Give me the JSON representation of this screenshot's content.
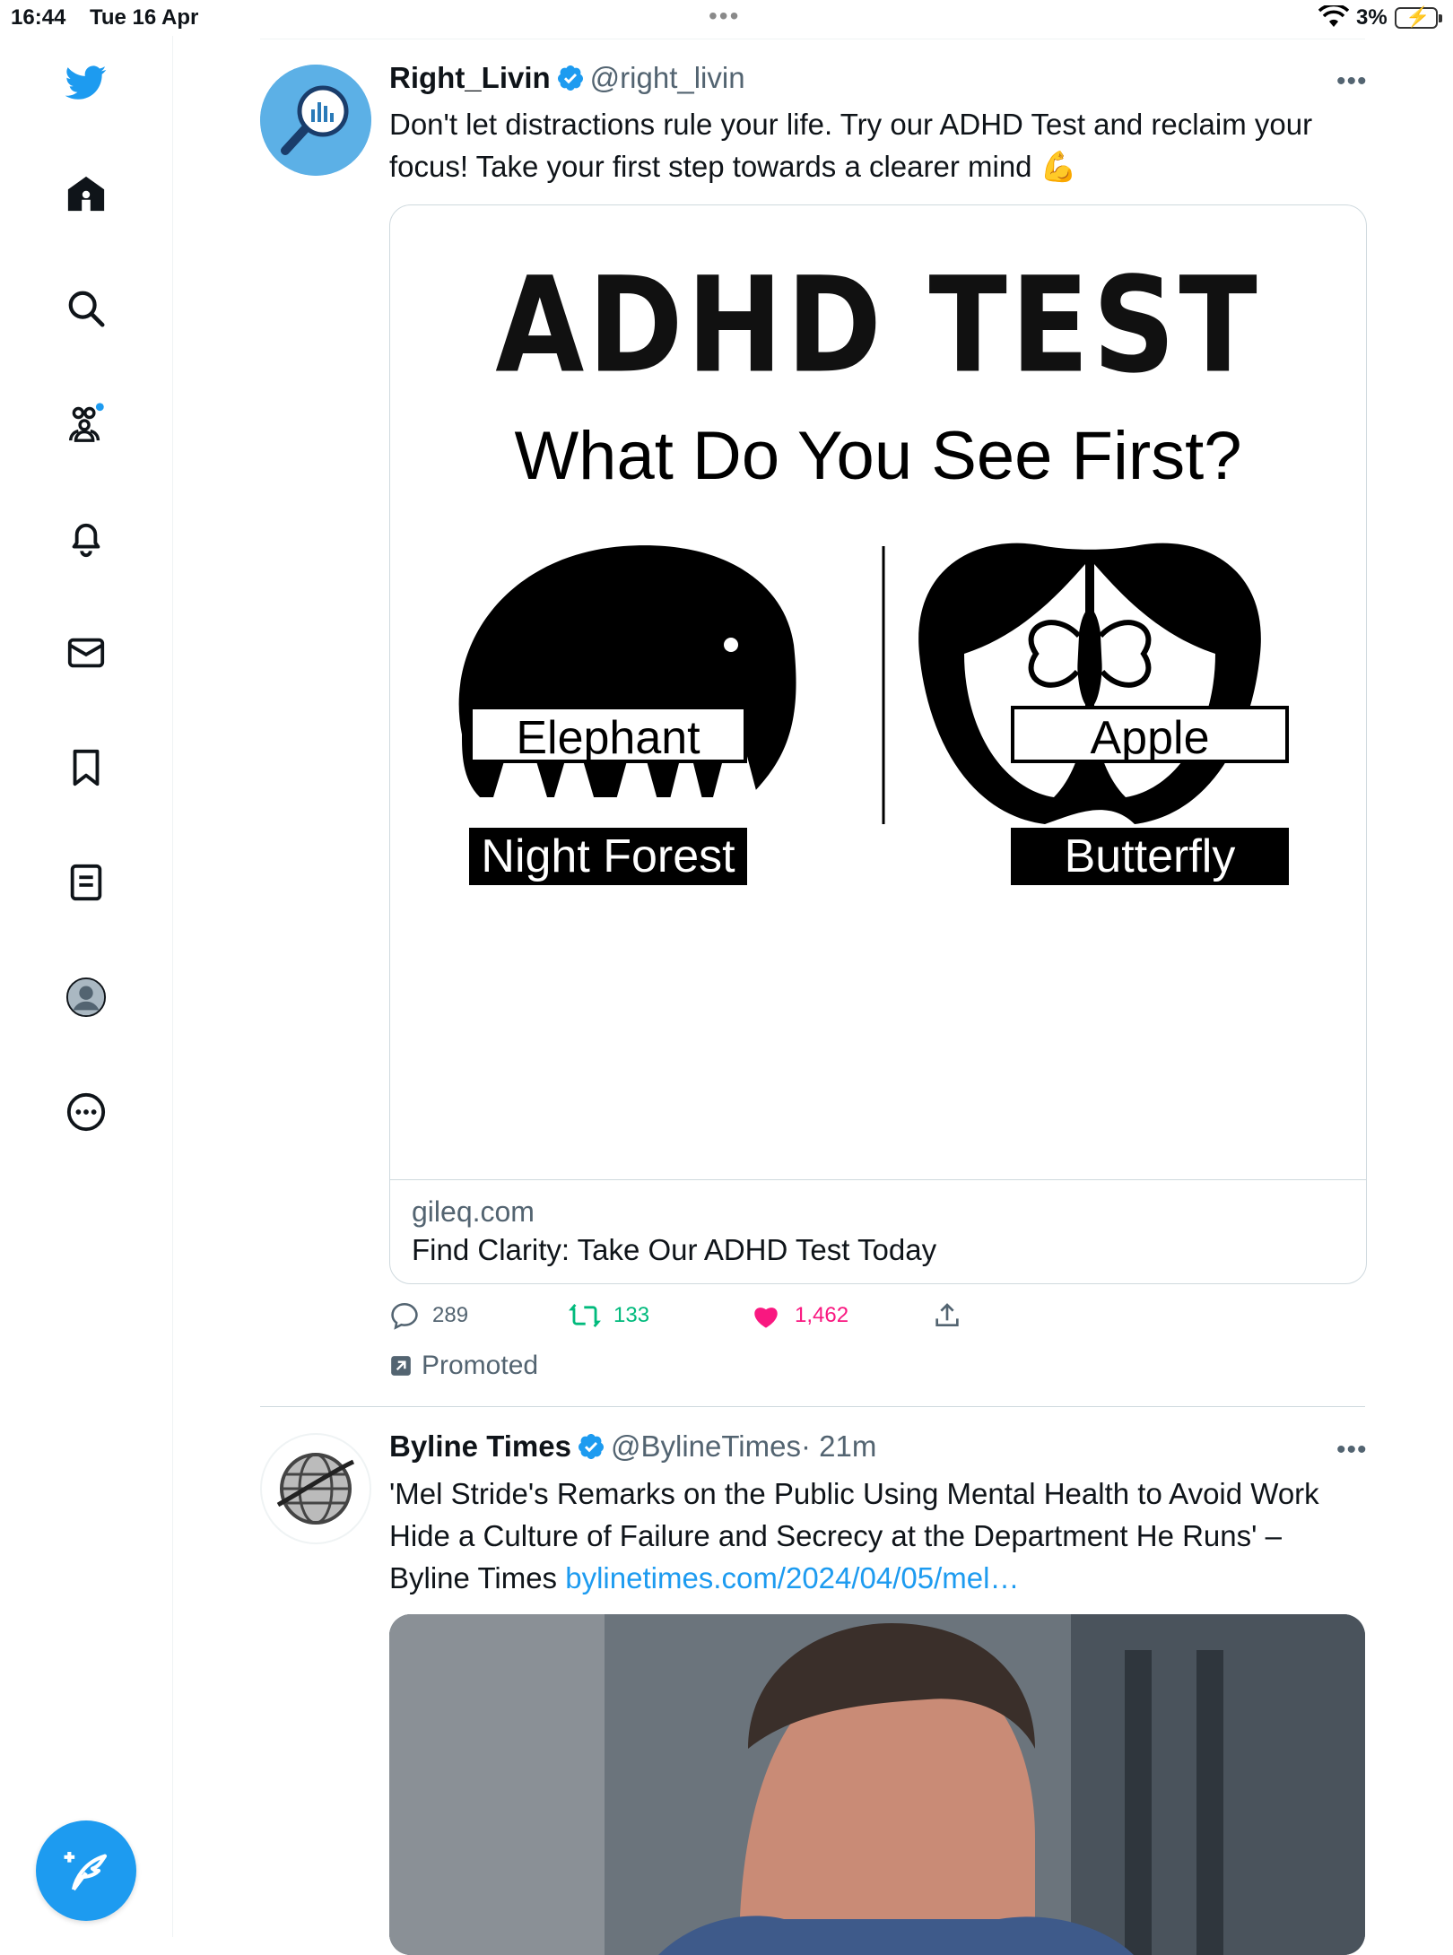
{
  "status_bar": {
    "time": "16:44",
    "date": "Tue 16 Apr",
    "battery": "3%"
  },
  "sidebar": {
    "items": [
      "home",
      "explore",
      "communities",
      "notifications",
      "messages",
      "bookmarks",
      "lists",
      "profile",
      "more"
    ]
  },
  "tweets": [
    {
      "name": "Right_Livin",
      "handle": "@right_livin",
      "text_line1": "Don't let distractions rule your life. Try our ADHD Test and reclaim your",
      "text_line2": "focus! Take your first step towards a clearer mind 💪",
      "card": {
        "title": "ADHD TEST",
        "subtitle": "What Do You See First?",
        "options": [
          "Elephant",
          "Apple",
          "Night Forest",
          "Butterfly"
        ],
        "domain": "gileq.com",
        "caption": "Find Clarity: Take Our ADHD Test Today"
      },
      "replies": "289",
      "retweets": "133",
      "likes": "1,462",
      "promoted": "Promoted"
    },
    {
      "name": "Byline Times",
      "handle": "@BylineTimes",
      "time": "· 21m",
      "text_line1": "'Mel Stride's Remarks on the Public Using Mental Health to Avoid Work",
      "text_line2": "Hide a Culture of Failure and Secrecy at the Department He Runs' –",
      "text_line3_prefix": "Byline Times ",
      "text_link": "bylinetimes.com/2024/04/05/mel…"
    }
  ],
  "colors": {
    "accent": "#1d9bf0",
    "like": "#f91880",
    "retweet": "#00ba7c"
  }
}
